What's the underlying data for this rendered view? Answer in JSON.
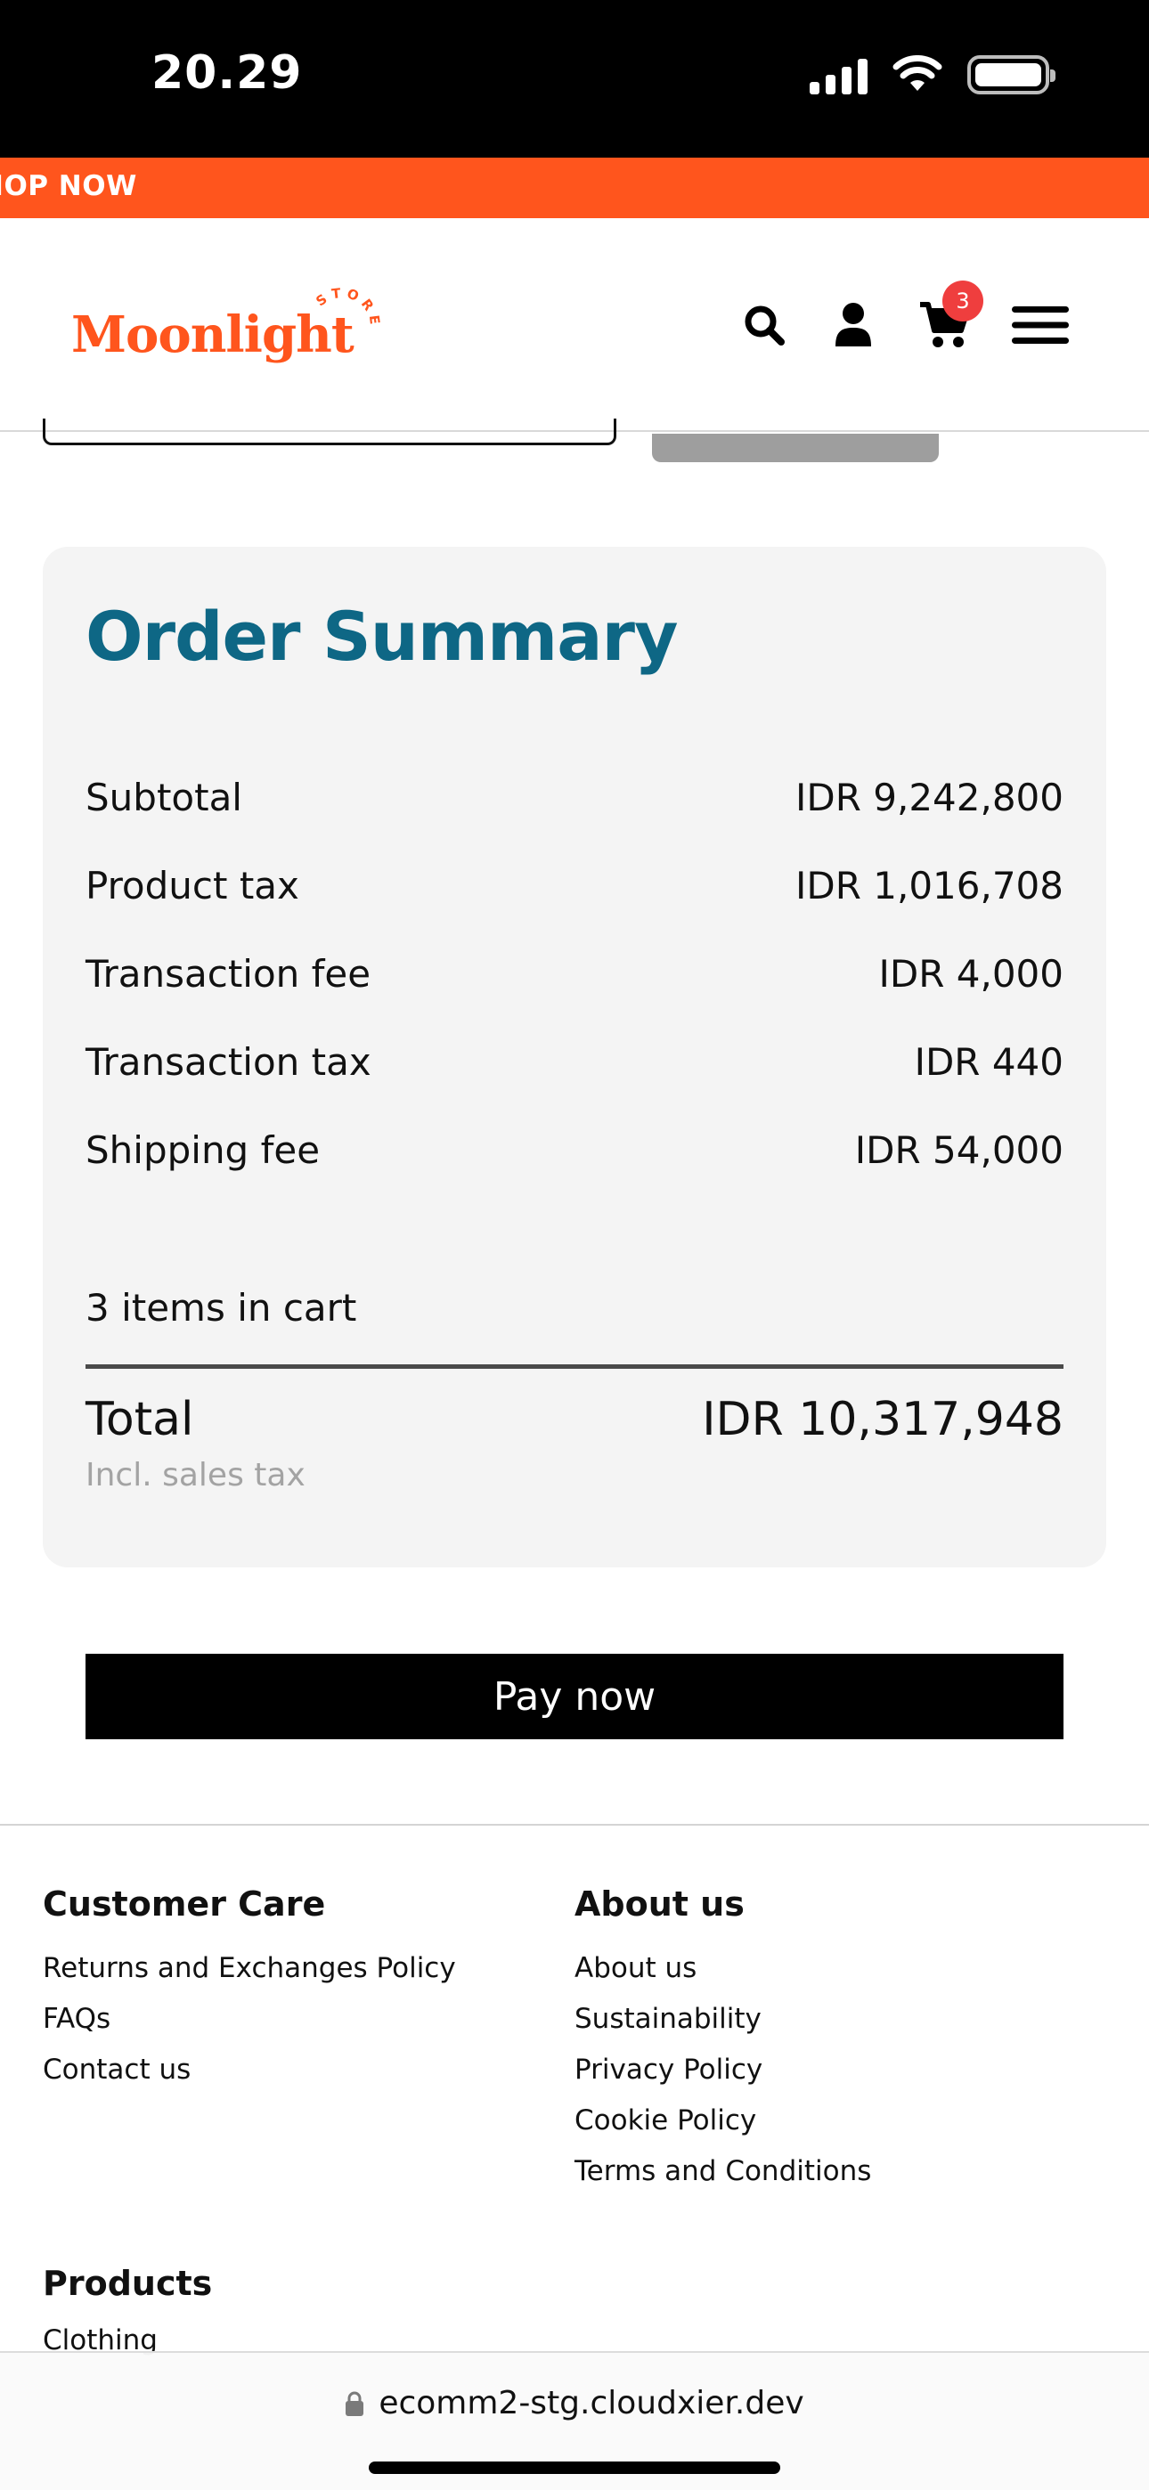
{
  "status_bar": {
    "time": "20.29"
  },
  "promo": {
    "text": "HOP NOW"
  },
  "header": {
    "logo_text": "Moonlight",
    "logo_sub": "STORE",
    "cart_count": "3"
  },
  "order_summary": {
    "title": "Order Summary",
    "rows": [
      {
        "label": "Subtotal",
        "value": "IDR 9,242,800"
      },
      {
        "label": "Product tax",
        "value": "IDR 1,016,708"
      },
      {
        "label": "Transaction fee",
        "value": "IDR 4,000"
      },
      {
        "label": "Transaction tax",
        "value": "IDR 440"
      },
      {
        "label": "Shipping fee",
        "value": "IDR 54,000"
      }
    ],
    "items_count": "3 items in cart",
    "total_label": "Total",
    "total_value": "IDR 10,317,948",
    "tax_note": "Incl. sales tax"
  },
  "pay_button": {
    "label": "Pay now"
  },
  "footer": {
    "customer_care": {
      "heading": "Customer Care",
      "links": [
        "Returns and Exchanges Policy",
        "FAQs",
        "Contact us"
      ]
    },
    "about": {
      "heading": "About us",
      "links": [
        "About us",
        "Sustainability",
        "Privacy Policy",
        "Cookie Policy",
        "Terms and Conditions"
      ]
    },
    "products": {
      "heading": "Products",
      "links": [
        "Clothing"
      ]
    }
  },
  "browser": {
    "url": "ecomm2-stg.cloudxier.dev"
  },
  "colors": {
    "brand_orange": "#ff551d",
    "title_teal": "#0e6785",
    "badge_red": "#ef3e3e"
  }
}
